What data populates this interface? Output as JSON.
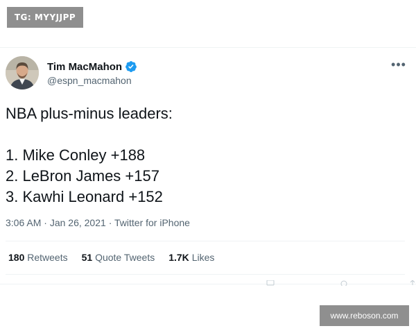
{
  "watermark_top_left": "TG: MYYJJPP",
  "watermark_bottom_right": "www.reboson.com",
  "tweet": {
    "author_name": "Tim MacMahon",
    "author_handle": "@espn_macmahon",
    "verified": true,
    "more_icon": "ellipsis-icon",
    "text_lines": [
      "NBA plus-minus leaders:",
      "",
      "1. Mike Conley +188",
      "2. LeBron James +157",
      "3. Kawhi Leonard +152"
    ],
    "time": "3:06 AM",
    "separator": "·",
    "date": "Jan 26, 2021",
    "source": "Twitter for iPhone",
    "stats": {
      "retweets_count": "180",
      "retweets_label": "Retweets",
      "quotes_count": "51",
      "quotes_label": "Quote Tweets",
      "likes_count": "1.7K",
      "likes_label": "Likes"
    }
  },
  "colors": {
    "text_primary": "#0f1419",
    "text_secondary": "#536471",
    "verified_blue": "#1d9bf0",
    "border": "#eff3f4",
    "watermark_bg": "#8f8f8f"
  }
}
